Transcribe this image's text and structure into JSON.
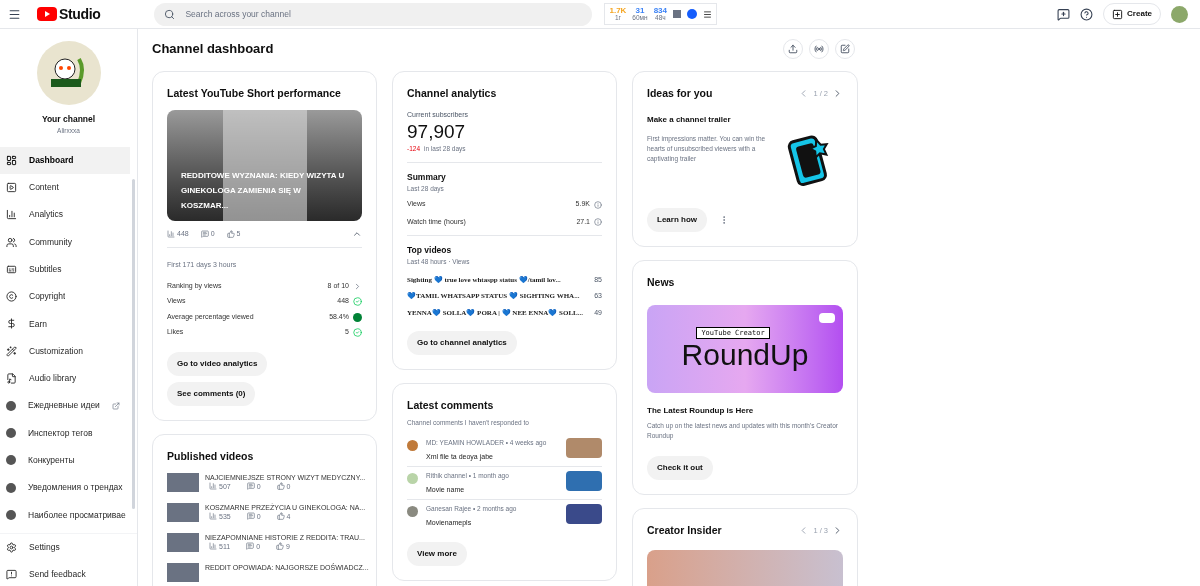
{
  "topbar": {
    "logo_text": "Studio",
    "search": {
      "placeholder": "Search across your channel"
    },
    "widget": [
      {
        "value": "1.7K",
        "caption": "1г",
        "color": "#f5a623"
      },
      {
        "value": "31",
        "caption": "60мн",
        "color": "#3b82f6"
      },
      {
        "value": "834",
        "caption": "48ч",
        "color": "#3b82f6"
      }
    ],
    "create_button": "Create"
  },
  "sidebar": {
    "channel_label": "Your channel",
    "channel_name": "Alirxxxa",
    "items": [
      {
        "label": "Dashboard",
        "kind": "nav",
        "selected": true,
        "external": false
      },
      {
        "label": "Content",
        "kind": "nav",
        "selected": false,
        "external": false
      },
      {
        "label": "Analytics",
        "kind": "nav",
        "selected": false,
        "external": false
      },
      {
        "label": "Community",
        "kind": "nav",
        "selected": false,
        "external": false
      },
      {
        "label": "Subtitles",
        "kind": "nav",
        "selected": false,
        "external": false
      },
      {
        "label": "Copyright",
        "kind": "nav",
        "selected": false,
        "external": false
      },
      {
        "label": "Earn",
        "kind": "nav",
        "selected": false,
        "external": false
      },
      {
        "label": "Customization",
        "kind": "nav",
        "selected": false,
        "external": false
      },
      {
        "label": "Audio library",
        "kind": "nav",
        "selected": false,
        "external": false
      },
      {
        "label": "Ежедневные идеи",
        "kind": "extension",
        "selected": false,
        "external": true
      },
      {
        "label": "Инспектор тегов",
        "kind": "extension",
        "selected": false,
        "external": false
      },
      {
        "label": "Конкуренты",
        "kind": "extension",
        "selected": false,
        "external": false
      },
      {
        "label": "Уведомления о трендах",
        "kind": "extension",
        "selected": false,
        "external": false
      },
      {
        "label": "Наиболее просматривае",
        "kind": "extension",
        "selected": false,
        "external": false
      }
    ],
    "footer": [
      "Settings",
      "Send feedback"
    ]
  },
  "page_title": "Channel dashboard",
  "short_performance": {
    "title": "Latest YouTube Short performance",
    "video_title": "REDDITOWE WYZNANIA: KIEDY WIZYTA U GINEKOLOGA ZAMIENIA SIĘ W KOSZMAR...",
    "views": "448",
    "comments": "0",
    "likes": "5",
    "expanded": true,
    "period": "First 171 days 3 hours",
    "metrics": [
      {
        "label": "Ranking by views",
        "value": "8 of 10",
        "kind": "link"
      },
      {
        "label": "Views",
        "value": "448",
        "kind": "check"
      },
      {
        "label": "Average percentage viewed",
        "value": "58.4%",
        "kind": "above"
      },
      {
        "label": "Likes",
        "value": "5",
        "kind": "check"
      }
    ],
    "buttons": [
      "Go to video analytics",
      "See comments (0)"
    ]
  },
  "published_videos": {
    "title": "Published videos",
    "videos": [
      {
        "title": "NAJCIEMNIEJSZE STRONY WIZYT MEDYCZNY...",
        "views": "507",
        "comments": "0",
        "likes": "0"
      },
      {
        "title": "KOSZMARNE PRZEŻYCIA U GINEKOLOGA: NA...",
        "views": "535",
        "comments": "0",
        "likes": "4"
      },
      {
        "title": "NIEZAPOMNIANE HISTORIE Z REDDITA: TRAU...",
        "views": "511",
        "comments": "0",
        "likes": "9"
      },
      {
        "title": "REDDIT OPOWIADA: NAJGORSZE DOŚWIADCZ..."
      }
    ]
  },
  "channel_analytics": {
    "title": "Channel analytics",
    "subscribers_label": "Current subscribers",
    "subscribers": "97,907",
    "change": "-124",
    "change_period": "in last 28 days",
    "summary": {
      "title": "Summary",
      "period": "Last 28 days",
      "rows": [
        {
          "label": "Views",
          "value": "5.9K"
        },
        {
          "label": "Watch time (hours)",
          "value": "27.1"
        }
      ]
    },
    "top_videos": {
      "title": "Top videos",
      "period": "Last 48 hours · Views",
      "rows": [
        {
          "title": "Sighting 💙 true love whtaspp status 💙/tamil lov...",
          "views": "85"
        },
        {
          "title": "💙TAMIL WHATSAPP STATUS 💙 SIGHTING WHA...",
          "views": "63"
        },
        {
          "title": "YENNA💙 SOLLA💙 PORA | 💙 NEE ENNA💙 SOLL...",
          "views": "49"
        }
      ]
    },
    "button": "Go to channel analytics"
  },
  "latest_comments": {
    "title": "Latest comments",
    "subtitle": "Channel comments I haven't responded to",
    "items": [
      {
        "meta": "MD: YEAMIN HOWLADER • 4 weeks ago",
        "text": "Xml file ta deoya jabe"
      },
      {
        "meta": "Rithik channel • 1 month ago",
        "text": "Movie name"
      },
      {
        "meta": "Ganesan Rajee • 2 months ago",
        "text": "Movienamepls"
      }
    ],
    "button": "View more"
  },
  "ideas": {
    "title": "Ideas for you",
    "pager": "1 / 2",
    "idea_title": "Make a channel trailer",
    "text": "First impressions matter. You can win the hearts of unsubscribed viewers with a captivating trailer",
    "button": "Learn how"
  },
  "news": {
    "title": "News",
    "banner_label": "YouTube Creator",
    "banner_title": "RoundUp",
    "headline": "The Latest Roundup is Here",
    "text": "Catch up on the latest news and updates with this month's Creator Roundup",
    "button": "Check it out"
  },
  "creator_insider": {
    "title": "Creator Insider",
    "pager": "1 / 3"
  }
}
